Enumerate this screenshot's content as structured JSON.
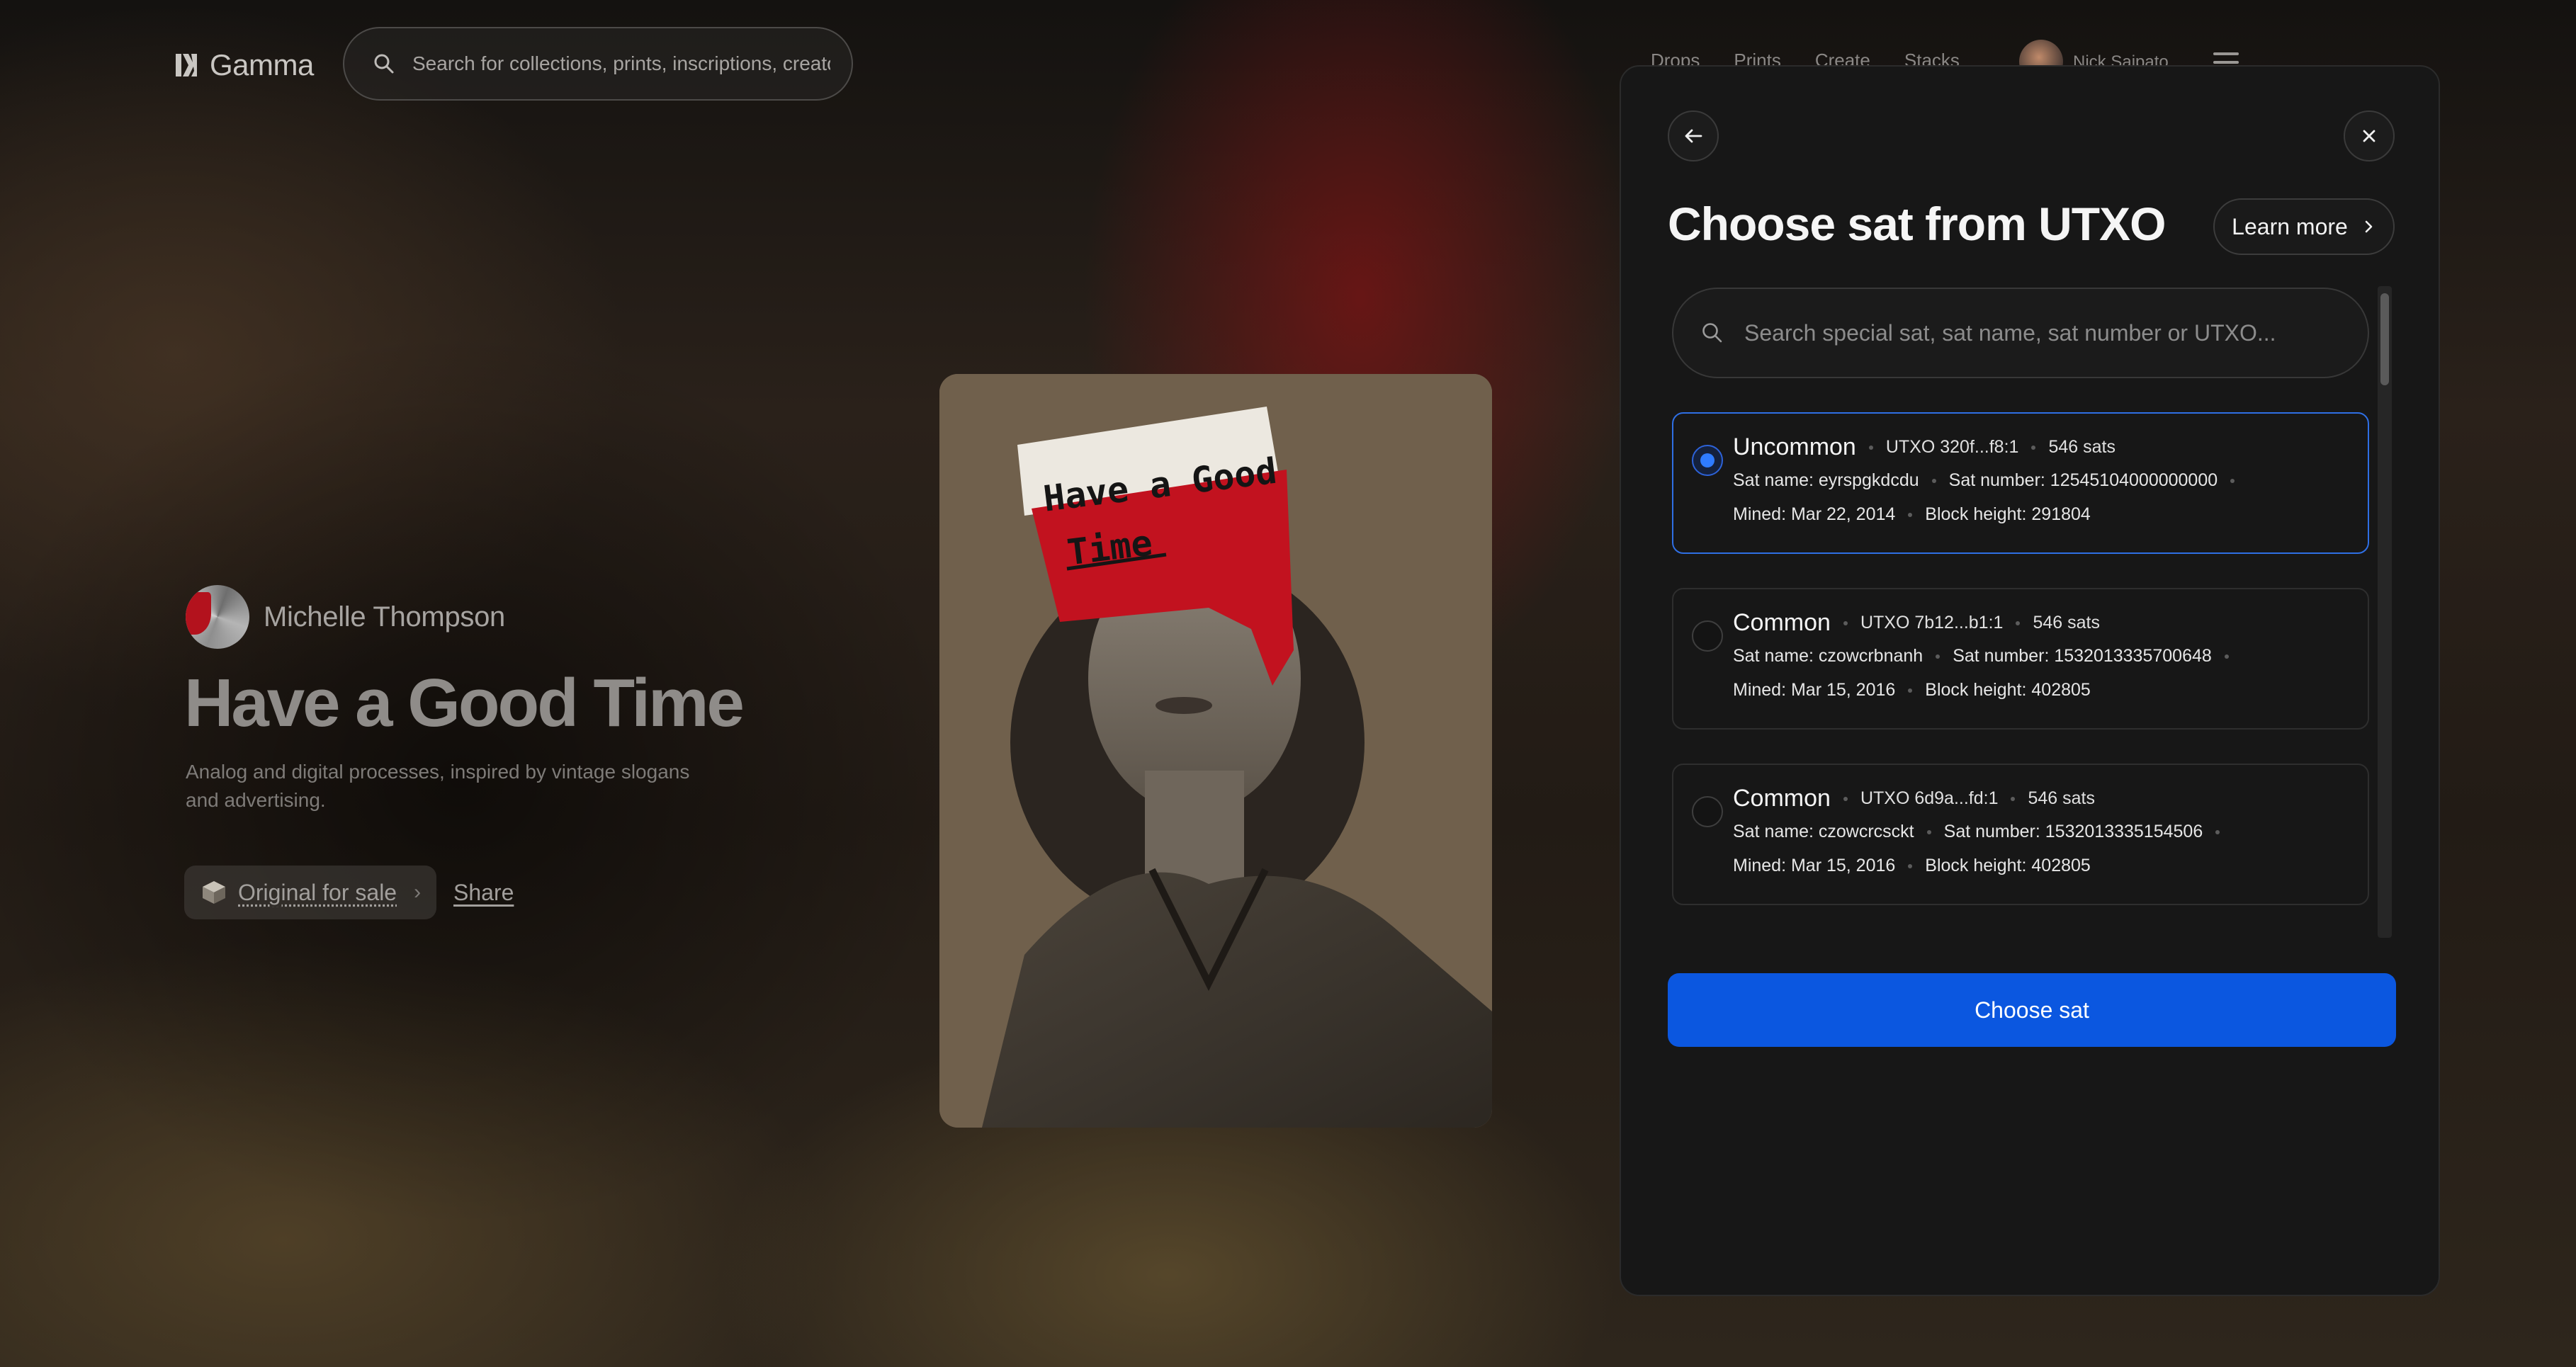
{
  "header": {
    "logo_text": "Gamma",
    "search_placeholder": "Search for collections, prints, inscriptions, creato",
    "nav": [
      "Drops",
      "Prints",
      "Create",
      "Stacks"
    ],
    "user_name": "Nick Saipato"
  },
  "hero": {
    "artist_name": "Michelle Thompson",
    "title": "Have a Good Time",
    "description": "Analog and digital processes, inspired by vintage slogans and advertising.",
    "sale_label": "Original for sale",
    "share_label": "Share"
  },
  "artwork": {
    "line1": "Have a Good",
    "line2": "Time"
  },
  "modal": {
    "title": "Choose sat from UTXO",
    "learn_more": "Learn more",
    "search_placeholder": "Search special sat, sat name, sat number or UTXO...",
    "choose_button": "Choose sat",
    "sats": [
      {
        "rarity": "Uncommon",
        "utxo": "UTXO 320f...f8:1",
        "amount": "546 sats",
        "sat_name": "Sat name: eyrspgkdcdu",
        "sat_number": "Sat number: 12545104000000000",
        "mined": "Mined: Mar 22, 2014",
        "block_height": "Block height: 291804",
        "selected": true
      },
      {
        "rarity": "Common",
        "utxo": "UTXO 7b12...b1:1",
        "amount": "546 sats",
        "sat_name": "Sat name: czowcrbnanh",
        "sat_number": "Sat number: 1532013335700648",
        "mined": "Mined: Mar 15, 2016",
        "block_height": "Block height: 402805",
        "selected": false
      },
      {
        "rarity": "Common",
        "utxo": "UTXO 6d9a...fd:1",
        "amount": "546 sats",
        "sat_name": "Sat name: czowcrcsckt",
        "sat_number": "Sat number: 1532013335154506",
        "mined": "Mined: Mar 15, 2016",
        "block_height": "Block height: 402805",
        "selected": false
      }
    ]
  },
  "colors": {
    "accent": "#0b57e0",
    "selected_border": "#2f6fe4",
    "modal_bg": "#171717"
  },
  "icons": [
    "gamma-logo-icon",
    "search-icon",
    "menu-icon",
    "arrow-left-icon",
    "close-icon",
    "chevron-right-icon",
    "box-icon"
  ]
}
